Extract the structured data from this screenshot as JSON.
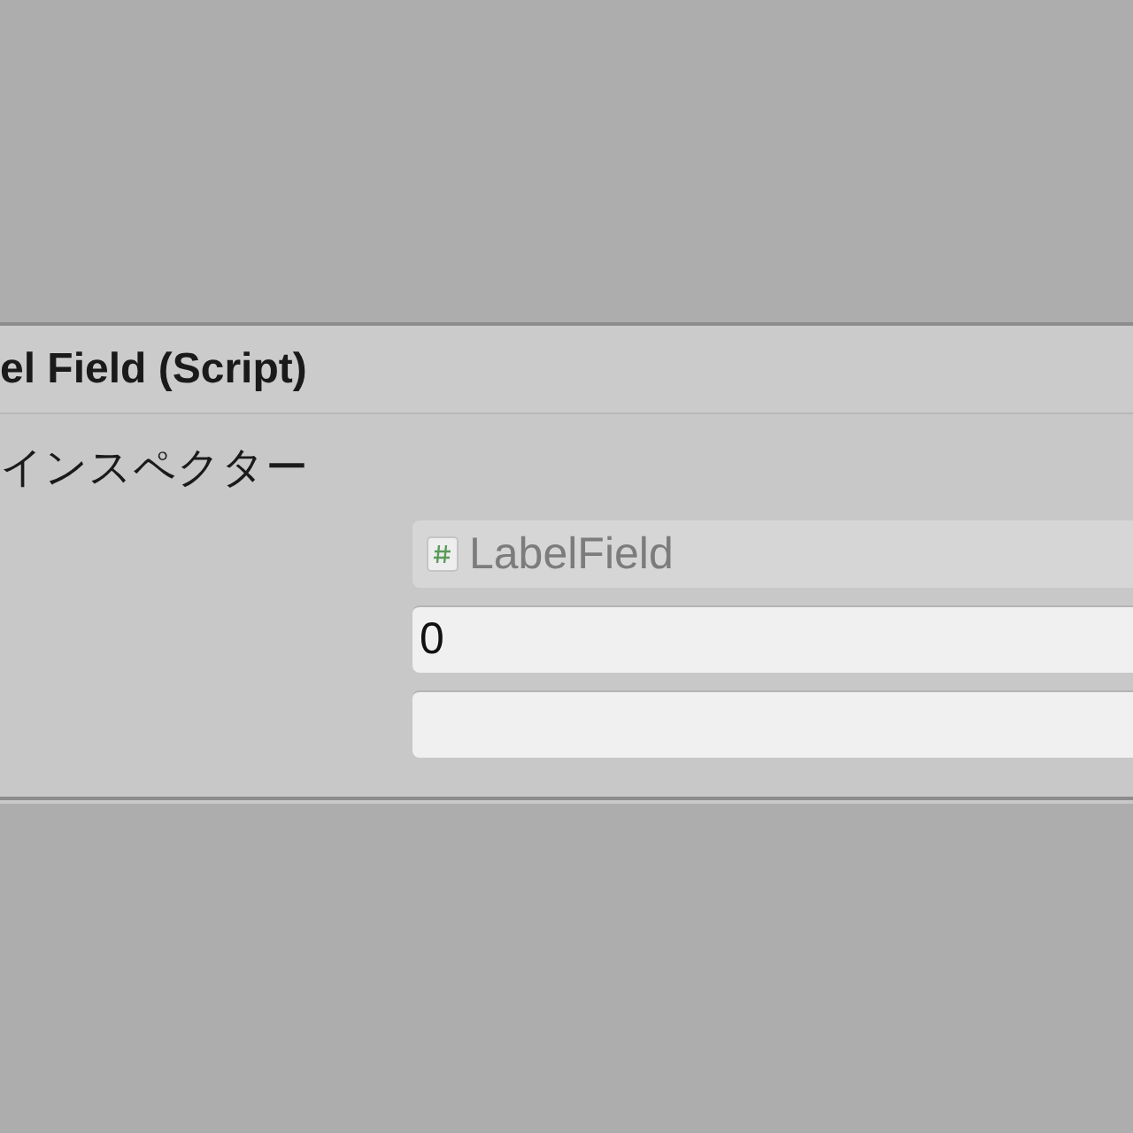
{
  "component": {
    "title": "el Field (Script)"
  },
  "section": {
    "label": "インスペクター"
  },
  "fields": [
    {
      "kind": "script",
      "value": "LabelField",
      "disabled": true
    },
    {
      "kind": "text",
      "value": "0",
      "disabled": false
    },
    {
      "kind": "text",
      "disabled": false
    }
  ]
}
